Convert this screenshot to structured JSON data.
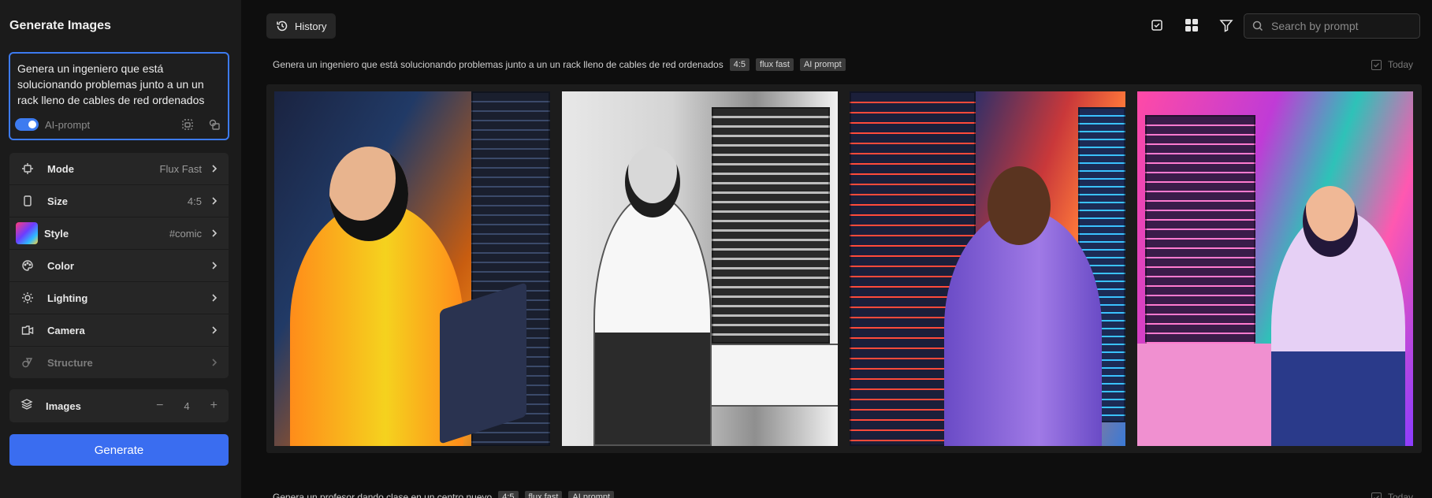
{
  "sidebar": {
    "title": "Generate Images",
    "prompt": {
      "value": "Genera un ingeniero que está solucionando problemas junto a un un rack lleno de cables de red ordenados",
      "ai_prompt_label": "AI-prompt",
      "ai_prompt_enabled": true
    },
    "options": [
      {
        "label": "Mode",
        "value": "Flux Fast",
        "icon": "mode-icon"
      },
      {
        "label": "Size",
        "value": "4:5",
        "icon": "size-icon"
      },
      {
        "label": "Style",
        "value": "#comic",
        "icon": "style-thumbnail"
      },
      {
        "label": "Color",
        "value": "",
        "icon": "palette-icon"
      },
      {
        "label": "Lighting",
        "value": "",
        "icon": "sun-icon"
      },
      {
        "label": "Camera",
        "value": "",
        "icon": "camera-icon"
      },
      {
        "label": "Structure",
        "value": "",
        "icon": "structure-icon"
      }
    ],
    "images": {
      "label": "Images",
      "count": "4",
      "minus": "−",
      "plus": "+"
    },
    "generate_label": "Generate"
  },
  "main": {
    "history_label": "History",
    "search_placeholder": "Search by prompt",
    "groups": [
      {
        "prompt": "Genera un ingeniero que está solucionando problemas junto a un un rack lleno de cables de red ordenados",
        "tags": [
          "4:5",
          "flux fast",
          "AI prompt"
        ],
        "date_label": "Today",
        "images": [
          "image-1",
          "image-2",
          "image-3",
          "image-4"
        ]
      },
      {
        "prompt": "Genera un profesor dando clase en un centro nuevo",
        "tags": [
          "4:5",
          "flux fast",
          "AI prompt"
        ],
        "date_label": "Today"
      }
    ]
  },
  "colors": {
    "accent": "#3a6df0",
    "sidebar_bg": "#1b1b1b",
    "page_bg": "#0e0e0e"
  }
}
